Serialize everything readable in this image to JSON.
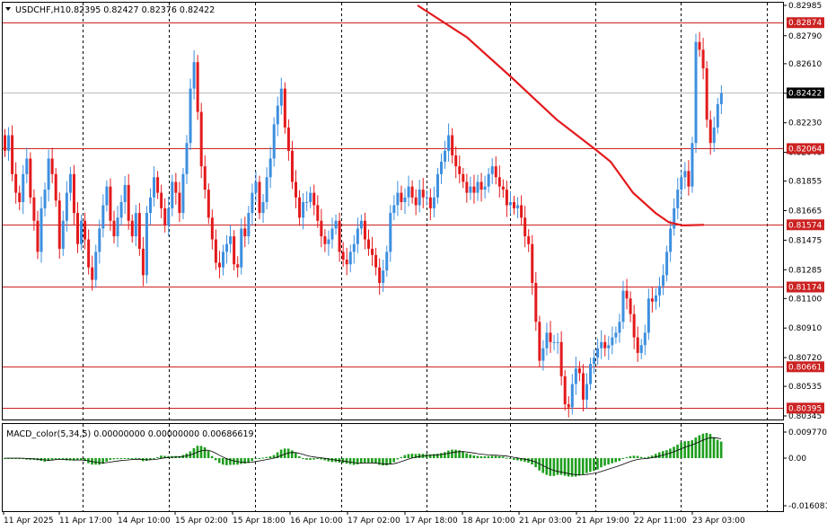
{
  "header": {
    "symbol_label": "USDCHF,H1",
    "ohlc": "0.82395 0.82427 0.82376 0.82422",
    "dropdown_icon": "triangle-down-icon"
  },
  "macd": {
    "label": "MACD_color(5,34,5) 0.00000000 0.00000000 0.00686619",
    "axis_labels": [
      {
        "value": 0.0097701,
        "text": "0.0097701"
      },
      {
        "value": 0.0,
        "text": "0.00"
      },
      {
        "value": -0.0160815,
        "text": "-0.0160815"
      }
    ]
  },
  "price_axis": {
    "ticks": [
      "0.82985",
      "0.82790",
      "0.82610",
      "0.82420",
      "0.82230",
      "0.82040",
      "0.81855",
      "0.81665",
      "0.81475",
      "0.81285",
      "0.81100",
      "0.80910",
      "0.80720",
      "0.80535",
      "0.80345"
    ],
    "current_price": "0.82422",
    "hlines": [
      {
        "value": 0.82874,
        "text": "0.82874"
      },
      {
        "value": 0.82064,
        "text": "0.82064"
      },
      {
        "value": 0.81574,
        "text": "0.81574"
      },
      {
        "value": 0.81174,
        "text": "0.81174"
      },
      {
        "value": 0.80661,
        "text": "0.80661"
      },
      {
        "value": 0.80395,
        "text": "0.80395"
      }
    ]
  },
  "time_axis": {
    "labels": [
      "11 Apr 2025",
      "11 Apr 17:00",
      "14 Apr 10:00",
      "15 Apr 02:00",
      "15 Apr 18:00",
      "16 Apr 10:00",
      "17 Apr 02:00",
      "17 Apr 18:00",
      "18 Apr 10:00",
      "21 Apr 03:00",
      "21 Apr 19:00",
      "22 Apr 11:00",
      "23 Apr 03:00"
    ]
  },
  "colors": {
    "bull": "#3d8fdf",
    "bear": "#e31a1c",
    "ma": "#e31a1c",
    "hline": "#cc2222",
    "macd_up": "#1e9e1e",
    "macd_down": "#e31a1c",
    "current_bg": "#000000"
  },
  "chart_data": {
    "type": "candlestick",
    "title": "USDCHF,H1",
    "ylim": [
      0.80345,
      0.82985
    ],
    "closes": [
      0.8205,
      0.8215,
      0.819,
      0.8178,
      0.8172,
      0.819,
      0.82,
      0.8175,
      0.816,
      0.814,
      0.8168,
      0.818,
      0.82,
      0.819,
      0.8173,
      0.8142,
      0.816,
      0.8178,
      0.819,
      0.8165,
      0.8145,
      0.816,
      0.8148,
      0.813,
      0.8122,
      0.814,
      0.8155,
      0.817,
      0.8182,
      0.816,
      0.815,
      0.8162,
      0.8172,
      0.8183,
      0.816,
      0.815,
      0.8165,
      0.8142,
      0.8125,
      0.8165,
      0.8175,
      0.8188,
      0.8178,
      0.8168,
      0.8157,
      0.8168,
      0.8185,
      0.8178,
      0.8165,
      0.819,
      0.821,
      0.8245,
      0.8262,
      0.823,
      0.8195,
      0.818,
      0.8162,
      0.8148,
      0.8133,
      0.813,
      0.814,
      0.8145,
      0.815,
      0.8132,
      0.813,
      0.8155,
      0.815,
      0.8165,
      0.8178,
      0.8185,
      0.8165,
      0.8172,
      0.8188,
      0.82,
      0.8222,
      0.8234,
      0.8245,
      0.822,
      0.8205,
      0.8185,
      0.8175,
      0.8162,
      0.8172,
      0.8172,
      0.8178,
      0.817,
      0.816,
      0.815,
      0.8145,
      0.8148,
      0.8155,
      0.816,
      0.814,
      0.8135,
      0.8132,
      0.814,
      0.8145,
      0.8155,
      0.816,
      0.8148,
      0.8142,
      0.8138,
      0.813,
      0.812,
      0.8128,
      0.814,
      0.8165,
      0.817,
      0.8178,
      0.8172,
      0.8175,
      0.8182,
      0.8175,
      0.817,
      0.818,
      0.8175,
      0.8175,
      0.8168,
      0.8175,
      0.819,
      0.8198,
      0.8205,
      0.8215,
      0.8202,
      0.8195,
      0.819,
      0.8185,
      0.8178,
      0.8182,
      0.8178,
      0.8185,
      0.818,
      0.8182,
      0.819,
      0.8195,
      0.8188,
      0.8182,
      0.818,
      0.817,
      0.8172,
      0.8168,
      0.817,
      0.8162,
      0.815,
      0.8145,
      0.812,
      0.8095,
      0.807,
      0.8078,
      0.8088,
      0.8082,
      0.8082,
      0.8082,
      0.806,
      0.8042,
      0.804,
      0.8055,
      0.8065,
      0.8062,
      0.8045,
      0.8055,
      0.8068,
      0.8072,
      0.8078,
      0.8082,
      0.8078,
      0.808,
      0.8085,
      0.8088,
      0.8095,
      0.8115,
      0.811,
      0.81,
      0.8085,
      0.8075,
      0.808,
      0.8088,
      0.811,
      0.8108,
      0.8112,
      0.8118,
      0.8125,
      0.814,
      0.8155,
      0.8168,
      0.818,
      0.8188,
      0.8192,
      0.8182,
      0.821,
      0.8275,
      0.827,
      0.8258,
      0.8225,
      0.821,
      0.822,
      0.8235,
      0.8242
    ]
  }
}
